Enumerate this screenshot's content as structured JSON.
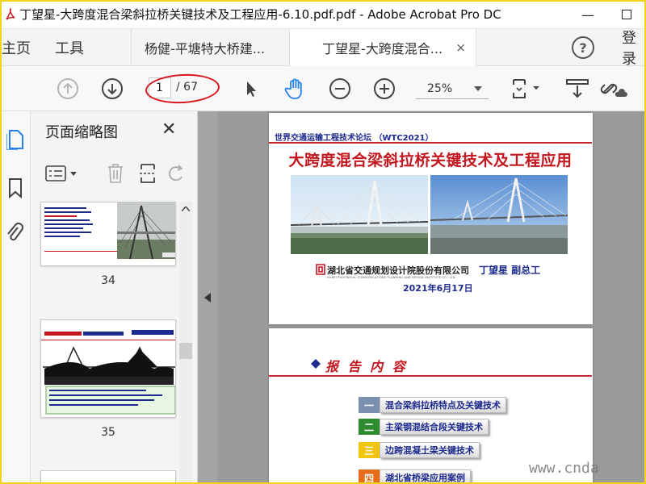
{
  "window": {
    "title": "丁望星-大跨度混合梁斜拉桥关键技术及工程应用-6.10.pdf.pdf - Adobe Acrobat Pro DC",
    "minimize": "—",
    "maximize": "☐"
  },
  "tabs": {
    "home": "主页",
    "tools": "工具",
    "docs": [
      {
        "label": "杨健-平塘特大桥建..."
      },
      {
        "label": "丁望星-大跨度混合...",
        "close": "×"
      }
    ],
    "help": "?",
    "signin": "登录"
  },
  "toolbar": {
    "page_current": "1",
    "page_total": "/ 67",
    "zoom": "25%"
  },
  "thumbnail_panel": {
    "title": "页面缩略图",
    "close": "✕",
    "thumbnails": [
      {
        "number": "34"
      },
      {
        "number": "35"
      }
    ]
  },
  "document": {
    "page1": {
      "forum": "世界交通运输工程技术论坛 （WTC2021）",
      "title": "大跨度混合梁斜拉桥关键技术及工程应用",
      "institute": "湖北省交通规划设计院股份有限公司",
      "institute_en": "HUBEI PROVINCIAL COMMUNICATIONS PLANNING AND DESIGN INSTITUTE CO., LTD",
      "author": "丁望星  副总工",
      "date": "2021年6月17日"
    },
    "page2": {
      "title": "报 告 内 容",
      "items": [
        {
          "num": "一",
          "text": "混合梁斜拉桥特点及关键技术",
          "color": "#7b8fb0"
        },
        {
          "num": "二",
          "text": "主梁钢混结合段关键技术",
          "color": "#2e8b2e"
        },
        {
          "num": "三",
          "text": "边跨混凝土梁关键技术",
          "color": "#f1c40f"
        },
        {
          "num": "四",
          "text": "湖北省桥梁应用案例",
          "color": "#e86b1a"
        }
      ]
    }
  },
  "watermark": "www.cnda",
  "colors": {
    "annotation_red": "#d8151b",
    "title_red": "#c3161e",
    "title_blue": "#1d2a8e",
    "acrobat_blue": "#2680eb",
    "frame_yellow": "#f2d21b"
  }
}
